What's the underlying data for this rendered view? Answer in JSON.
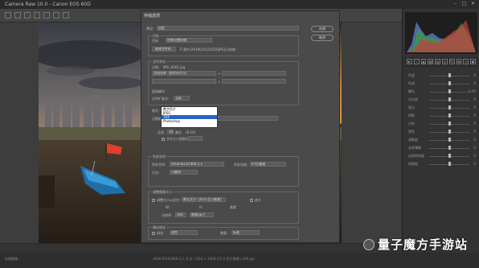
{
  "window": {
    "title": "Camera Raw 10.0 - Canon EOS 60D"
  },
  "dialog": {
    "title": "存储选项",
    "save_button": "存储",
    "cancel_button": "取消",
    "preset_label": "预设：",
    "preset_value": "自定",
    "destination_section": "目标",
    "destination_label": "目标：",
    "destination_value": "在新位置存储",
    "select_folder_button": "选择文件夹...",
    "folder_path": "F:\\照片\\2018\\10\\15\\CR2\\JPG(已存储)",
    "filename_section": "文件命名",
    "example_label": "示例：",
    "example_value": "IMG_0001.jpg",
    "filename_field1": "文档名称（首字母大写）",
    "plus": "+",
    "start_number_label": "起始编号：",
    "extension_label": "文件扩展名：",
    "extension_value": ".jpg",
    "format_label": "格式：",
    "format_value": "JPEG",
    "metadata_label": "元数据：",
    "quality_label": "品质：",
    "quality_value": "10",
    "quality_text": "最佳",
    "quality_range": "(8-10)",
    "limit_size_label": "文件大小限制为：",
    "color_space_section": "色彩空间",
    "color_space_label": "色彩空间：",
    "color_space_value": "sRGB IEC61966-2.1",
    "color_depth_label": "色彩深度：",
    "color_depth_value": "8 位/通道",
    "intent_label": "方法：",
    "intent_value": "可感知",
    "resize_section": "调整图像大小",
    "resize_label": "调整大小以适合：",
    "resize_value": "默认大小（24.0 百万像素）",
    "enlarge_label": "放大",
    "w_label": "W：",
    "h_label": "H：",
    "pixels_label": "像素",
    "res_label": "分辨率：",
    "res_value": "300",
    "res_unit": "像素/英寸",
    "sharpen_section": "输出锐化",
    "sharpen_label": "锐化：",
    "sharpen_target": "滤色",
    "sharpen_amount_label": "数量：",
    "sharpen_amount_value": "标准"
  },
  "format_dropdown": {
    "options": [
      "数字负片",
      "JPEG",
      "TIFF",
      "Photoshop"
    ],
    "selected": 2
  },
  "status": {
    "left": "存储图像...",
    "center": "sRGB IEC61966-2.1; 8 位; 5184 × 3456 (17.9 百万像素); 240 ppi"
  },
  "panel_params": [
    {
      "label": "色温",
      "value": "0"
    },
    {
      "label": "色调",
      "value": "0"
    },
    {
      "label": "曝光",
      "value": "0.00"
    },
    {
      "label": "对比度",
      "value": "0"
    },
    {
      "label": "高光",
      "value": "0"
    },
    {
      "label": "阴影",
      "value": "0"
    },
    {
      "label": "白色",
      "value": "0"
    },
    {
      "label": "黑色",
      "value": "0"
    },
    {
      "label": "清晰度",
      "value": "0"
    },
    {
      "label": "去除薄雾",
      "value": "0"
    },
    {
      "label": "自然饱和度",
      "value": "0"
    },
    {
      "label": "饱和度",
      "value": "0"
    }
  ],
  "watermark": {
    "text": "量子魔方手游站"
  },
  "icons": [
    "crop-icon",
    "zoom-icon",
    "hand-icon",
    "eyedropper-icon",
    "straighten-icon",
    "brush-icon",
    "gradient-icon",
    "redeye-icon",
    "rotate-icon",
    "settings-icon"
  ]
}
